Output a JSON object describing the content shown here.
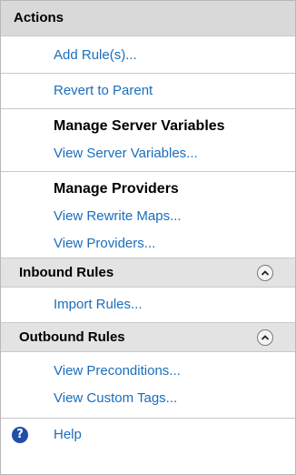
{
  "header": {
    "title": "Actions"
  },
  "actions": {
    "add_rules": "Add Rule(s)...",
    "revert_to_parent": "Revert to Parent"
  },
  "server_variables": {
    "heading": "Manage Server Variables",
    "view": "View Server Variables..."
  },
  "providers": {
    "heading": "Manage Providers",
    "view_rewrite_maps": "View Rewrite Maps...",
    "view_providers": "View Providers..."
  },
  "inbound": {
    "heading": "Inbound Rules",
    "collapse_icon": "chevron-up-icon",
    "import_rules": "Import Rules..."
  },
  "outbound": {
    "heading": "Outbound Rules",
    "collapse_icon": "chevron-up-icon",
    "view_preconditions": "View Preconditions...",
    "view_custom_tags": "View Custom Tags..."
  },
  "help": {
    "label": "Help",
    "icon": "help-icon",
    "glyph": "?"
  },
  "colors": {
    "link": "#1a6ebd",
    "header_bg": "#d9d9d9",
    "section_bg": "#e3e3e3",
    "help_icon_bg": "#1f4fa8"
  }
}
